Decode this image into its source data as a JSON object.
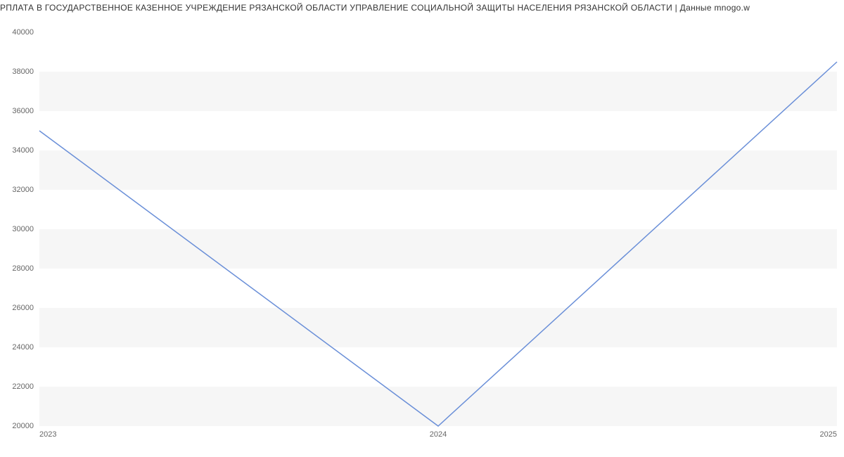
{
  "chart_data": {
    "type": "line",
    "title": "РПЛАТА В ГОСУДАРСТВЕННОЕ КАЗЕННОЕ УЧРЕЖДЕНИЕ РЯЗАНСКОЙ ОБЛАСТИ УПРАВЛЕНИЕ СОЦИАЛЬНОЙ ЗАЩИТЫ НАСЕЛЕНИЯ РЯЗАНСКОЙ ОБЛАСТИ | Данные mnogo.w",
    "x": [
      "2023",
      "2024",
      "2025"
    ],
    "values": [
      35000,
      20000,
      38500
    ],
    "xlabel": "",
    "ylabel": "",
    "ylim": [
      20000,
      40000
    ],
    "y_ticks": [
      20000,
      22000,
      24000,
      26000,
      28000,
      30000,
      32000,
      34000,
      36000,
      38000,
      40000
    ],
    "line_color": "#6a8fd8",
    "band_color": "#f6f6f6"
  }
}
